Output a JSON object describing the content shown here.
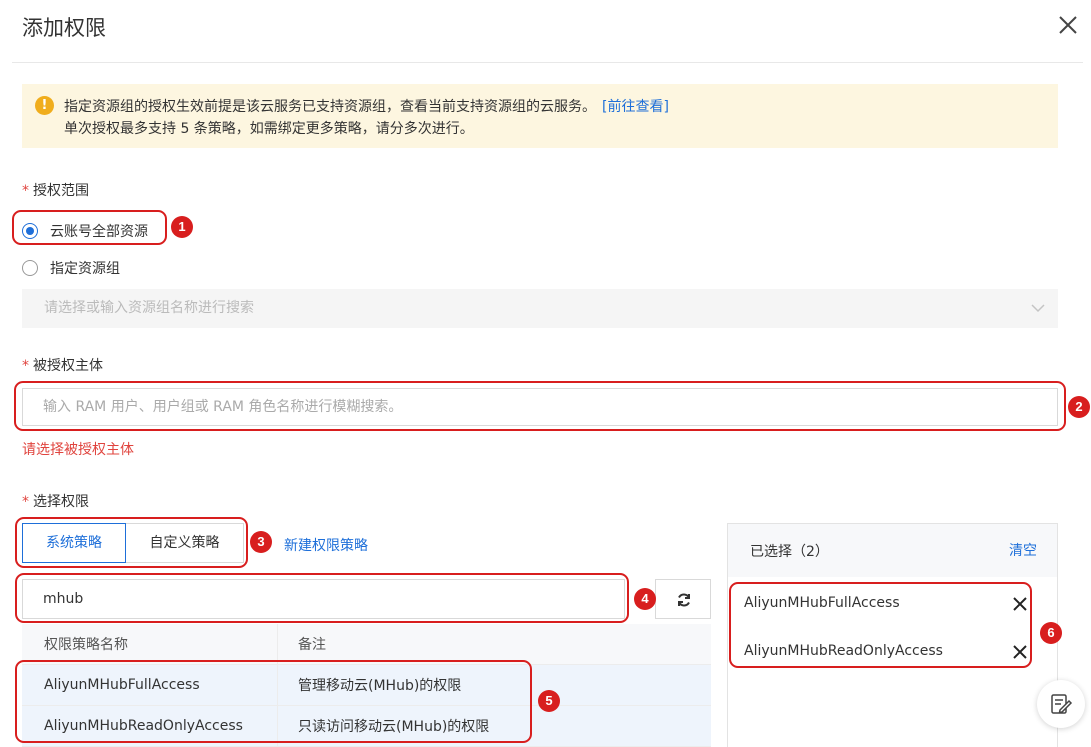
{
  "dialog": {
    "title": "添加权限"
  },
  "notice": {
    "line1": "指定资源组的授权生效前提是该云服务已支持资源组，查看当前支持资源组的云服务。",
    "link": "[前往查看]",
    "line2": "单次授权最多支持 5 条策略，如需绑定更多策略，请分多次进行。"
  },
  "scope": {
    "label": "授权范围",
    "options": [
      {
        "label": "云账号全部资源",
        "selected": true
      },
      {
        "label": "指定资源组",
        "selected": false
      }
    ],
    "select_placeholder": "请选择或输入资源组名称进行搜索"
  },
  "principal": {
    "label": "被授权主体",
    "placeholder": "输入 RAM 用户、用户组或 RAM 角色名称进行模糊搜索。",
    "error": "请选择被授权主体"
  },
  "permissions": {
    "label": "选择权限",
    "tabs": [
      "系统策略",
      "自定义策略"
    ],
    "new_policy_link": "新建权限策略",
    "search_value": "mhub",
    "table": {
      "headers": [
        "权限策略名称",
        "备注"
      ],
      "rows": [
        {
          "name": "AliyunMHubFullAccess",
          "note": "管理移动云(MHub)的权限"
        },
        {
          "name": "AliyunMHubReadOnlyAccess",
          "note": "只读访问移动云(MHub)的权限"
        }
      ]
    },
    "selected_panel": {
      "title": "已选择（2）",
      "clear": "清空",
      "items": [
        "AliyunMHubFullAccess",
        "AliyunMHubReadOnlyAccess"
      ]
    }
  },
  "callouts": [
    "1",
    "2",
    "3",
    "4",
    "5",
    "6"
  ],
  "colors": {
    "accent": "#1e6fd9",
    "error": "#e0443e",
    "callout": "#d81e1e",
    "warning": "#f0ad1c"
  }
}
